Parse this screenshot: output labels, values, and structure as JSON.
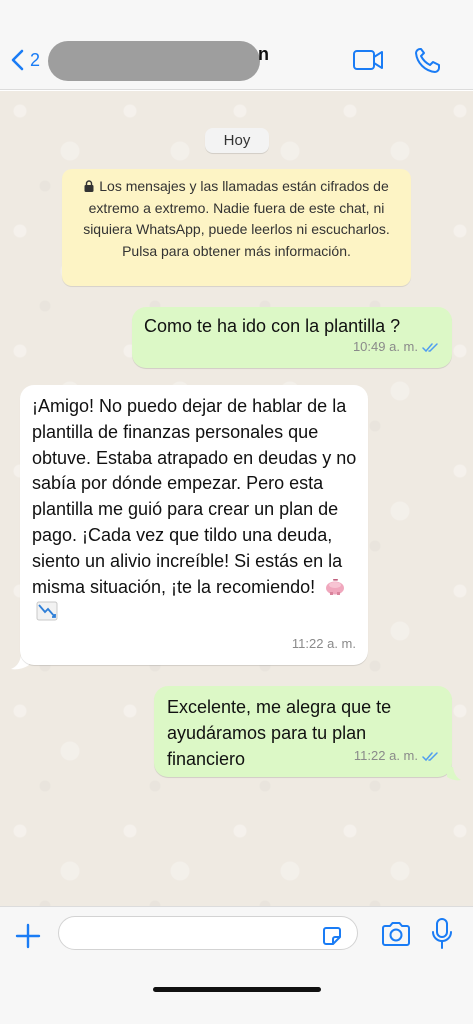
{
  "header": {
    "back_count": "2",
    "contact_name": "",
    "name_tail": "n",
    "icons": {
      "back": "chevron-left-icon",
      "video": "video-camera-icon",
      "call": "phone-icon"
    }
  },
  "chat": {
    "date_label": "Hoy",
    "encryption_notice": "Los mensajes y las llamadas están cifrados de extremo a extremo. Nadie fuera de este chat, ni siquiera WhatsApp, puede leerlos ni escucharlos. Pulsa para obtener más información.",
    "messages": [
      {
        "direction": "outgoing",
        "text": "Como te ha ido con la plantilla ?",
        "time": "10:49 a. m.",
        "status": "read"
      },
      {
        "direction": "incoming",
        "text": "¡Amigo! No puedo dejar de hablar de la plantilla de finanzas personales que obtuve. Estaba atrapado en deudas y no sabía por dónde empezar. Pero esta plantilla me guió para crear un plan de pago. ¡Cada vez que tildo una deuda, siento un alivio increíble! Si estás en la misma situación, ¡te la recomiendo!",
        "emojis": [
          "piggy-bank-emoji",
          "chart-decreasing-emoji"
        ],
        "time": "11:22 a. m."
      },
      {
        "direction": "outgoing",
        "text": "Excelente, me alegra que te ayudáramos para tu plan financiero",
        "time": "11:22 a. m.",
        "status": "read"
      }
    ]
  },
  "input": {
    "value": "",
    "placeholder": "",
    "icons": [
      "plus-icon",
      "sticker-icon",
      "camera-icon",
      "microphone-icon"
    ]
  },
  "colors": {
    "accent": "#1a7cf5",
    "outgoing_bubble": "#dcf8c6",
    "incoming_bubble": "#ffffff",
    "notice_bg": "#fdf4c5",
    "chat_bg": "#efeae2",
    "read_ticks": "#4f9df0"
  }
}
